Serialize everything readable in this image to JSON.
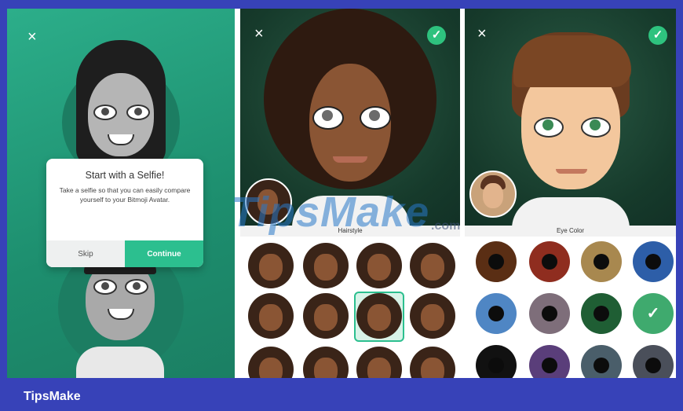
{
  "footer": {
    "brand": "TipsMake"
  },
  "watermark": {
    "main": "TipsMake",
    "suffix": ".com"
  },
  "panel1": {
    "close_icon": "×",
    "dialog": {
      "title": "Start with a Selfie!",
      "body": "Take a selfie so that you can easily compare yourself to your Bitmoji Avatar.",
      "skip_label": "Skip",
      "continue_label": "Continue"
    }
  },
  "panel2": {
    "close_icon": "×",
    "check_icon": "✓",
    "section_title": "Hairstyle",
    "hairstyles_count_visible": 12,
    "selected_index": 6
  },
  "panel3": {
    "close_icon": "×",
    "check_icon": "✓",
    "section_title": "Eye Color",
    "eye_colors": [
      "#5a2e14",
      "#8f2d1f",
      "#a8884f",
      "#2d5ea8",
      "#4f86c4",
      "#7e6e7a",
      "#1f5e34",
      "#3faa6e",
      "#111111",
      "#5a3e7a",
      "#4a5e6a",
      "#4a4f5a"
    ],
    "selected_index": 7
  },
  "colors": {
    "accent": "#2cbf8f",
    "frame_bg": "#3742b8"
  }
}
